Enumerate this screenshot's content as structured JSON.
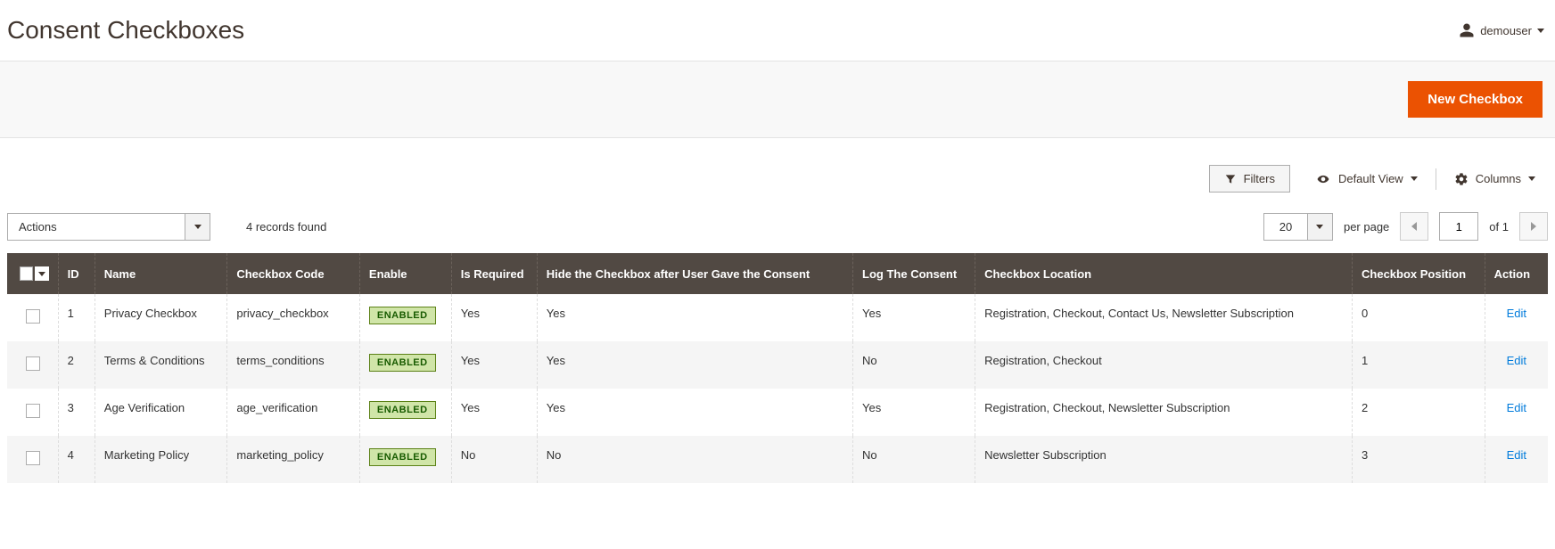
{
  "page": {
    "title": "Consent Checkboxes"
  },
  "user": {
    "name": "demouser"
  },
  "actions": {
    "new_button": "New Checkbox"
  },
  "toolbar": {
    "filters": "Filters",
    "default_view": "Default View",
    "columns": "Columns"
  },
  "grid_controls": {
    "actions_label": "Actions",
    "records_found": "4 records found",
    "page_size": "20",
    "per_page": "per page",
    "current_page": "1",
    "total_pages": "1",
    "of_label": "of"
  },
  "table": {
    "headers": {
      "id": "ID",
      "name": "Name",
      "code": "Checkbox Code",
      "enable": "Enable",
      "required": "Is Required",
      "hide": "Hide the Checkbox after User Gave the Consent",
      "log": "Log The Consent",
      "location": "Checkbox Location",
      "position": "Checkbox Position",
      "action": "Action"
    },
    "enabled_label": "ENABLED",
    "edit_label": "Edit",
    "rows": [
      {
        "id": "1",
        "name": "Privacy Checkbox",
        "code": "privacy_checkbox",
        "enabled": true,
        "required": "Yes",
        "hide": "Yes",
        "log": "Yes",
        "location": "Registration, Checkout, Contact Us, Newsletter Subscription",
        "position": "0"
      },
      {
        "id": "2",
        "name": "Terms & Conditions",
        "code": "terms_conditions",
        "enabled": true,
        "required": "Yes",
        "hide": "Yes",
        "log": "No",
        "location": "Registration, Checkout",
        "position": "1"
      },
      {
        "id": "3",
        "name": "Age Verification",
        "code": "age_verification",
        "enabled": true,
        "required": "Yes",
        "hide": "Yes",
        "log": "Yes",
        "location": "Registration, Checkout, Newsletter Subscription",
        "position": "2"
      },
      {
        "id": "4",
        "name": "Marketing Policy",
        "code": "marketing_policy",
        "enabled": true,
        "required": "No",
        "hide": "No",
        "log": "No",
        "location": "Newsletter Subscription",
        "position": "3"
      }
    ]
  }
}
